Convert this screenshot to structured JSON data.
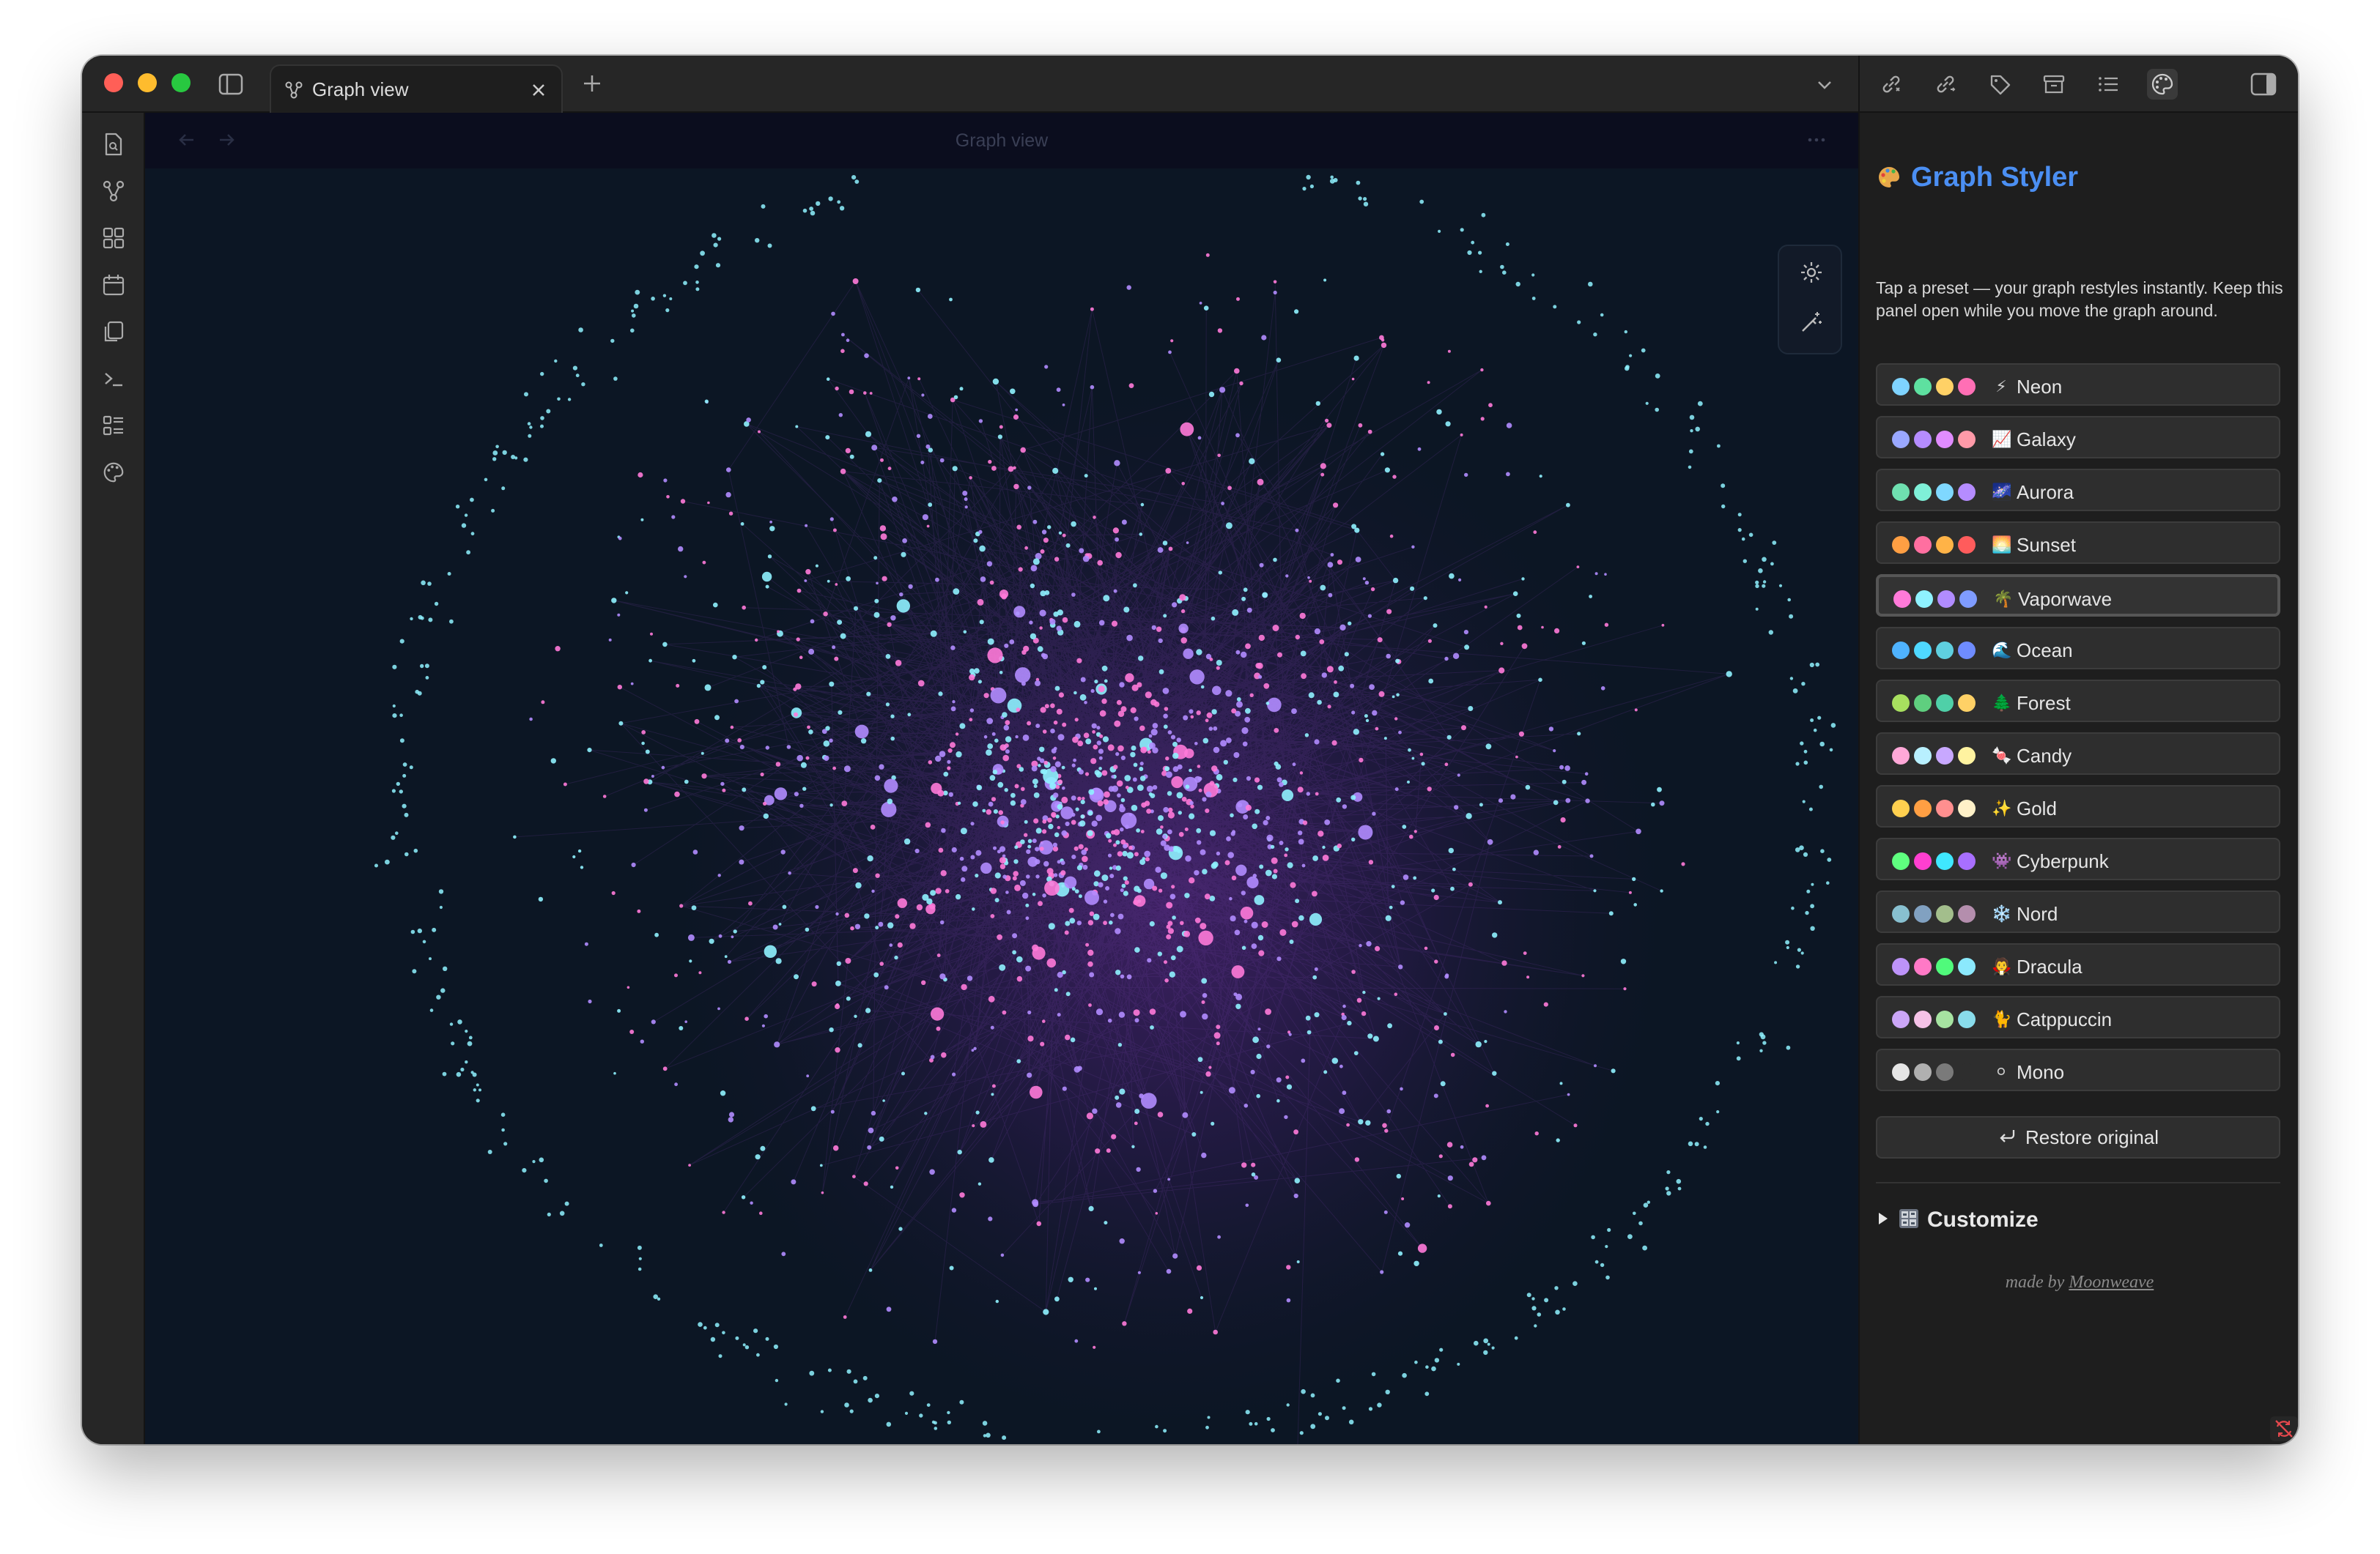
{
  "tab": {
    "title": "Graph view"
  },
  "view": {
    "title": "Graph view"
  },
  "panel": {
    "title": "Graph Styler",
    "title_icon": "palette-icon",
    "description": "Tap a preset — your graph restyles instantly. Keep this panel open while you move the graph around.",
    "presets": [
      {
        "label": "Neon",
        "icon": "⚡",
        "colors": [
          "#7fd3ff",
          "#5ee0a0",
          "#ffd166",
          "#ff6fb5"
        ]
      },
      {
        "label": "Galaxy",
        "icon": "📈",
        "colors": [
          "#9aa8ff",
          "#b58cff",
          "#e08cff",
          "#ff9aa8"
        ]
      },
      {
        "label": "Aurora",
        "icon": "🌌",
        "colors": [
          "#6fe0b0",
          "#7ff0d8",
          "#7fd8ff",
          "#b58cff"
        ]
      },
      {
        "label": "Sunset",
        "icon": "🌅",
        "colors": [
          "#ff9f43",
          "#ff6fa0",
          "#ffb347",
          "#ff5c5c"
        ]
      },
      {
        "label": "Vaporwave",
        "icon": "🌴",
        "colors": [
          "#ff7ad9",
          "#8ff2ff",
          "#b18cff",
          "#7f9cff"
        ]
      },
      {
        "label": "Ocean",
        "icon": "🌊",
        "colors": [
          "#4fb3ff",
          "#4fd8ff",
          "#5fd0e0",
          "#6f8cff"
        ]
      },
      {
        "label": "Forest",
        "icon": "🌲",
        "colors": [
          "#a8e05f",
          "#5fcf7f",
          "#4fd0a8",
          "#ffd166"
        ]
      },
      {
        "label": "Candy",
        "icon": "🍬",
        "colors": [
          "#ffa8d8",
          "#b8f0ff",
          "#c8a8ff",
          "#fff3a0"
        ]
      },
      {
        "label": "Gold",
        "icon": "✨",
        "colors": [
          "#ffd04f",
          "#ff9f43",
          "#ff8f8f",
          "#fff1c8"
        ]
      },
      {
        "label": "Cyberpunk",
        "icon": "👾",
        "colors": [
          "#5fff7f",
          "#ff3fd0",
          "#3fe8ff",
          "#a86fff"
        ]
      },
      {
        "label": "Nord",
        "icon": "❄️",
        "colors": [
          "#88c0d0",
          "#81a1c1",
          "#a3be8c",
          "#b48ead"
        ]
      },
      {
        "label": "Dracula",
        "icon": "🧛",
        "colors": [
          "#bd93f9",
          "#ff79c6",
          "#50fa7b",
          "#8be9fd"
        ]
      },
      {
        "label": "Catppuccin",
        "icon": "🐈",
        "colors": [
          "#cba6f7",
          "#f5c2e7",
          "#a6e3a1",
          "#89dceb"
        ]
      },
      {
        "label": "Mono",
        "icon": "⚪",
        "colors": [
          "#e6e6e6",
          "#b0b0b0",
          "#7a7a7a",
          "#2e2e2e"
        ]
      }
    ],
    "selected_preset": "Vaporwave",
    "restore_label": "Restore original",
    "customize_label": "Customize",
    "made_by_prefix": "made by",
    "made_by_link": "Moonweave"
  },
  "graph": {
    "link_color": "#6a3a9a",
    "node_colors": [
      "#ff7ad9",
      "#8ff2ff",
      "#b18cff"
    ],
    "background": "#0c1624"
  }
}
